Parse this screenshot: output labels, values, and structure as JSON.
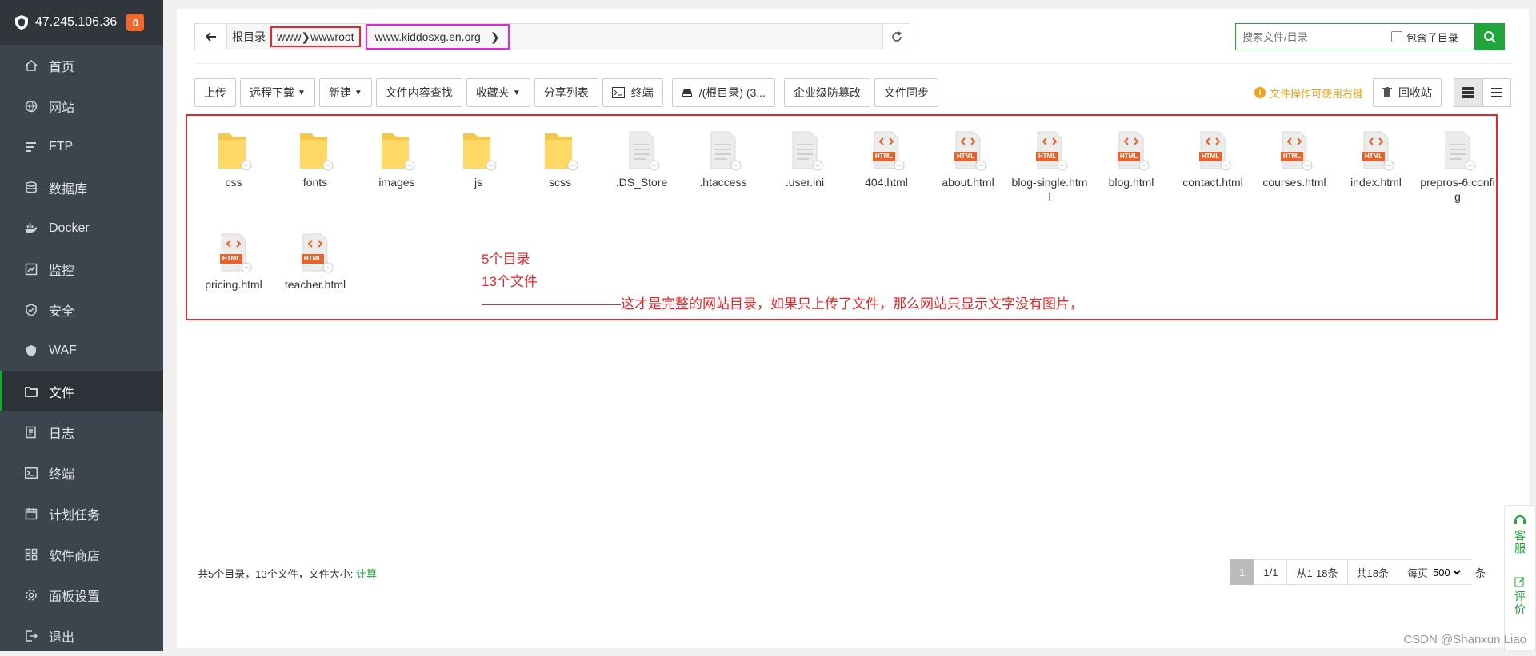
{
  "sidebar": {
    "ip": "47.245.106.36",
    "badge": "0",
    "items": [
      {
        "label": "首页",
        "icon": "home-icon"
      },
      {
        "label": "网站",
        "icon": "globe-icon"
      },
      {
        "label": "FTP",
        "icon": "ftp-icon"
      },
      {
        "label": "数据库",
        "icon": "database-icon"
      },
      {
        "label": "Docker",
        "icon": "docker-icon"
      },
      {
        "label": "监控",
        "icon": "monitor-icon"
      },
      {
        "label": "安全",
        "icon": "shield-icon"
      },
      {
        "label": "WAF",
        "icon": "waf-icon"
      },
      {
        "label": "文件",
        "icon": "folder-icon",
        "active": true
      },
      {
        "label": "日志",
        "icon": "log-icon"
      },
      {
        "label": "终端",
        "icon": "terminal-icon"
      },
      {
        "label": "计划任务",
        "icon": "calendar-icon"
      },
      {
        "label": "软件商店",
        "icon": "store-icon"
      },
      {
        "label": "面板设置",
        "icon": "gear-icon"
      },
      {
        "label": "退出",
        "icon": "logout-icon"
      }
    ]
  },
  "path": {
    "root": "根目录",
    "seg1": "www",
    "seg2": "wwwroot",
    "seg3": "www.kiddosxg.en.org"
  },
  "search": {
    "placeholder": "搜索文件/目录",
    "include_sub": "包含子目录"
  },
  "toolbar": {
    "upload": "上传",
    "remote_download": "远程下载",
    "new": "新建",
    "content_search": "文件内容查找",
    "favorites": "收藏夹",
    "share_list": "分享列表",
    "terminal": "终端",
    "disk": "/(根目录) (3...",
    "tamper": "企业级防篡改",
    "sync": "文件同步",
    "hint": "文件操作可使用右键",
    "recycle": "回收站"
  },
  "files": [
    {
      "name": "css",
      "type": "folder"
    },
    {
      "name": "fonts",
      "type": "folder"
    },
    {
      "name": "images",
      "type": "folder"
    },
    {
      "name": "js",
      "type": "folder"
    },
    {
      "name": "scss",
      "type": "folder"
    },
    {
      "name": ".DS_Store",
      "type": "file"
    },
    {
      "name": ".htaccess",
      "type": "file"
    },
    {
      "name": ".user.ini",
      "type": "file"
    },
    {
      "name": "404.html",
      "type": "html"
    },
    {
      "name": "about.html",
      "type": "html"
    },
    {
      "name": "blog-single.html",
      "type": "html"
    },
    {
      "name": "blog.html",
      "type": "html"
    },
    {
      "name": "contact.html",
      "type": "html"
    },
    {
      "name": "courses.html",
      "type": "html"
    },
    {
      "name": "index.html",
      "type": "html"
    },
    {
      "name": "prepros-6.config",
      "type": "file"
    },
    {
      "name": "pricing.html",
      "type": "html"
    },
    {
      "name": "teacher.html",
      "type": "html"
    }
  ],
  "html_badge": "HTML",
  "annotation": {
    "line1": "5个目录",
    "line2": "13个文件",
    "line3": "这才是完整的网站目录，如果只上传了文件，那么网站只显示文字没有图片，"
  },
  "footer": {
    "summary": "共5个目录，13个文件，文件大小:",
    "calc": "计算"
  },
  "pager": {
    "current": "1",
    "pages": "1/1",
    "range": "从1-18条",
    "total": "共18条",
    "per_page_label": "每页",
    "per_page": "500",
    "unit": "条"
  },
  "side_tab": {
    "service": "客服",
    "review": "评价"
  },
  "watermark": "CSDN @Shanxun Liao"
}
